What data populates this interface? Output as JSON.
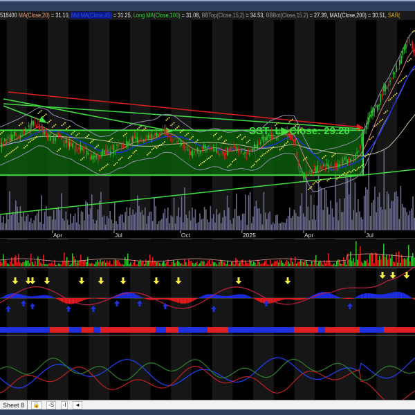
{
  "legend": {
    "prefix": "518400",
    "ma20": "MA(Close,20)",
    "ma20_value": " = 31.10, ",
    "mid_ma": "Mid MA(Close,45)",
    "mid_ma_value": " = 31.25, ",
    "long_ma": "Long MA(Close,100)",
    "long_ma_value": " = 31.08, ",
    "bbtop": "BBTop(Close,15,2)",
    "bbtop_value": " = 34.53, ",
    "bbbot": "BBBot(Close,15,2)",
    "bbbot_value": " = 27.39, ",
    "ma200": "MA1(Close,200)",
    "ma200_value": " = 30.51, ",
    "sar": "SAR("
  },
  "annotation": {
    "text": "SST_L▶Close: 29.20"
  },
  "sheet_bar": {
    "tab": "Sheet 8",
    "lock": "🔒",
    "btn_s": "-S",
    "btn_i": "-I",
    "scroll_left": "◄"
  },
  "colors": {
    "up": "#30c030",
    "down": "#e02020",
    "box": "#0a5a0a",
    "trend_red": "#e02020",
    "trend_green": "#40e040",
    "sar": "#f0e040",
    "blue": "#2030e0"
  },
  "chart_data": {
    "type": "candlestick",
    "title": "",
    "x_tick_labels": [
      "Apr",
      "Jul",
      "Oct",
      "2025",
      "Apr",
      "Jul"
    ],
    "x_tick_index": [
      14,
      27,
      41,
      54,
      67,
      80
    ],
    "period": "weekly",
    "closes": [
      29.5,
      29.8,
      30.2,
      30.0,
      30.4,
      30.8,
      31.2,
      31.0,
      31.6,
      32.0,
      32.6,
      32.2,
      31.5,
      31.0,
      30.6,
      31.2,
      30.8,
      30.2,
      30.0,
      29.6,
      29.8,
      29.2,
      28.6,
      28.4,
      28.8,
      29.4,
      29.0,
      29.6,
      30.0,
      29.8,
      30.4,
      30.8,
      30.6,
      30.2,
      30.8,
      31.0,
      31.4,
      31.8,
      31.2,
      30.8,
      30.4,
      30.0,
      29.6,
      29.2,
      29.0,
      29.4,
      29.8,
      30.0,
      29.6,
      29.2,
      28.8,
      29.4,
      29.8,
      29.6,
      29.2,
      28.8,
      29.4,
      30.0,
      30.4,
      30.8,
      31.2,
      30.8,
      31.4,
      31.6,
      31.0,
      30.6,
      27.2,
      26.2,
      26.8,
      27.0,
      27.4,
      27.2,
      27.6,
      27.4,
      27.8,
      28.0,
      28.2,
      28.4,
      28.8,
      30.0,
      32.0,
      33.5,
      34.0,
      35.0,
      36.5,
      37.0,
      38.5,
      39.0,
      41.0,
      42.0,
      41.5,
      40.0
    ],
    "range_box": {
      "top": 31.7,
      "bottom": 26.5,
      "label_close": 29.2
    },
    "indicator_values": {
      "MA(Close,20)": 31.1,
      "Mid MA(Close,45)": 31.25,
      "Long MA(Close,100)": 31.08,
      "BBTop(Close,15,2)": 34.53,
      "BBBot(Close,15,2)": 27.39,
      "MA1(Close,200)": 30.51
    }
  }
}
